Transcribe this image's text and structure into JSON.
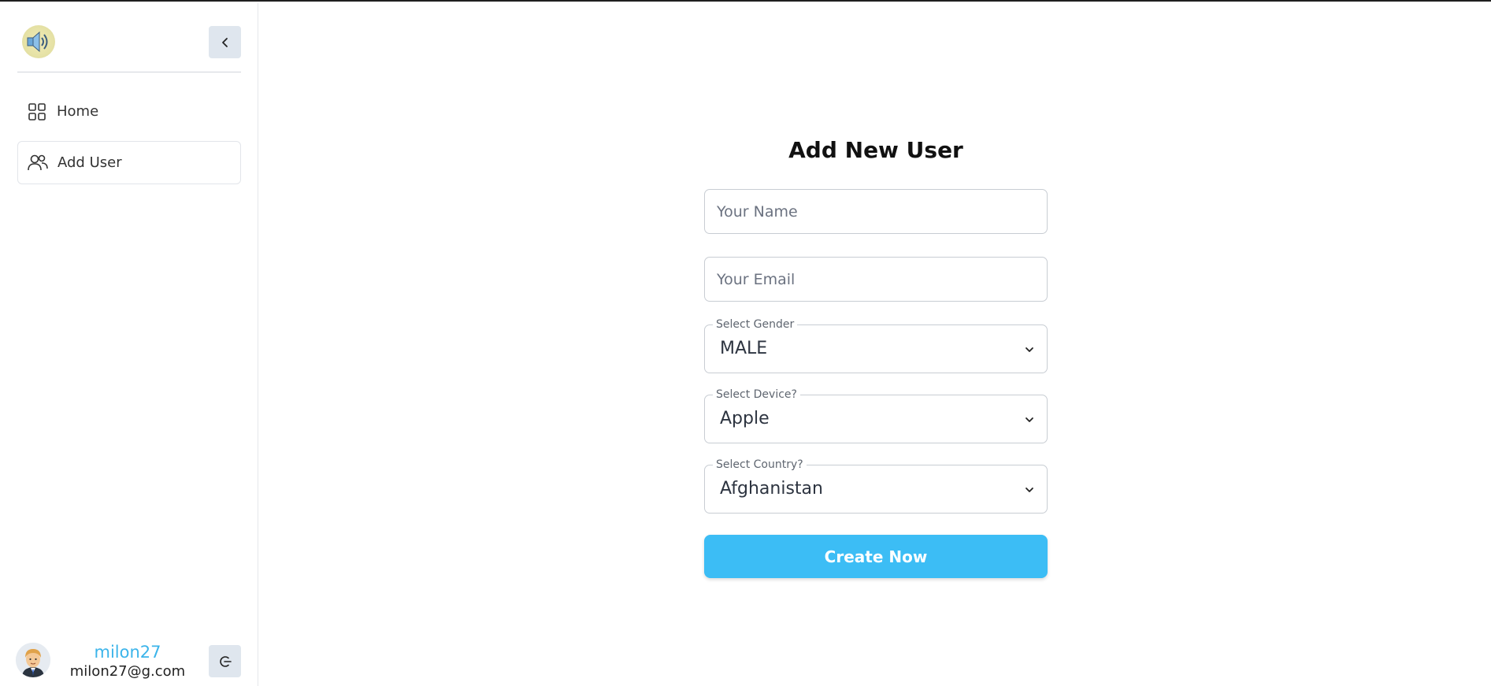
{
  "sidebar": {
    "logo_icon": "speaker-icon",
    "collapse_icon": "chevron-left-icon",
    "items": [
      {
        "label": "Home",
        "icon": "grid-icon"
      },
      {
        "label": "Add User",
        "icon": "users-icon",
        "active": true
      }
    ],
    "user": {
      "name": "milon27",
      "email": "milon27@g.com",
      "avatar_icon": "user-avatar",
      "logout_icon": "logout-icon"
    }
  },
  "form": {
    "title": "Add New User",
    "name_placeholder": "Your Name",
    "email_placeholder": "Your Email",
    "gender": {
      "label": "Select Gender",
      "value": "MALE"
    },
    "device": {
      "label": "Select Device?",
      "value": "Apple"
    },
    "country": {
      "label": "Select Country?",
      "value": "Afghanistan"
    },
    "submit_label": "Create Now"
  },
  "colors": {
    "accent": "#3cbdf5",
    "username": "#3bb4ea",
    "icon_button_bg": "#dfe6ee"
  }
}
